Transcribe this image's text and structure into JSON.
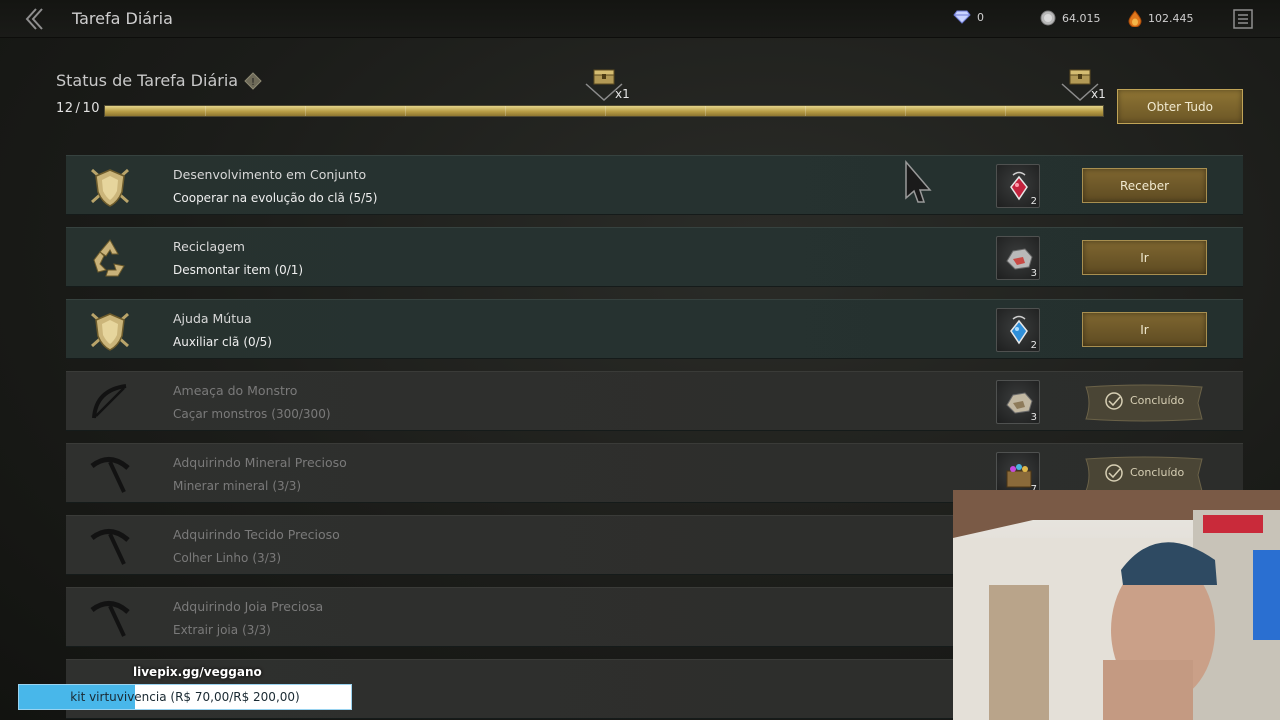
{
  "header": {
    "title": "Tarefa Diária",
    "currencies": [
      {
        "icon": "diamond-icon",
        "value": "0"
      },
      {
        "icon": "silver-coin-icon",
        "value": "64.015"
      },
      {
        "icon": "fire-gem-icon",
        "value": "102.445"
      }
    ]
  },
  "status": {
    "title": "Status de Tarefa Diária",
    "current": "12",
    "total": "10",
    "progress_fraction": 1.0,
    "milestones": [
      {
        "icon": "treasure-chest-icon",
        "multiplier": "x1"
      },
      {
        "icon": "treasure-chest-icon",
        "multiplier": "x1"
      }
    ],
    "obtain_all_label": "Obter Tudo"
  },
  "tasks": [
    {
      "name": "Desenvolvimento em Conjunto",
      "desc": "Cooperar na evolução do clã",
      "progress": "(5/5)",
      "icon": "clan-shield-icon",
      "reward_icon": "red-gem-amulet-icon",
      "reward_qty": "2",
      "action": "Receber",
      "done": false
    },
    {
      "name": "Reciclagem",
      "desc": "Desmontar item",
      "progress": "(0/1)",
      "icon": "recycle-icon",
      "reward_icon": "ore-chunk-icon",
      "reward_qty": "3",
      "action": "Ir",
      "done": false
    },
    {
      "name": "Ajuda Mútua",
      "desc": "Auxiliar clã",
      "progress": "(0/5)",
      "icon": "clan-shield-icon",
      "reward_icon": "blue-gem-amulet-icon",
      "reward_qty": "2",
      "action": "Ir",
      "done": false
    },
    {
      "name": "Ameaça do Monstro",
      "desc": "Caçar monstros",
      "progress": "(300/300)",
      "icon": "crossbow-icon",
      "reward_icon": "ore-chunk-icon",
      "reward_qty": "3",
      "action": "Concluído",
      "done": true
    },
    {
      "name": "Adquirindo Mineral Precioso",
      "desc": "Minerar mineral",
      "progress": "(3/3)",
      "icon": "pickaxe-icon",
      "reward_icon": "gem-chest-icon",
      "reward_qty": "7",
      "action": "Concluído",
      "done": true
    },
    {
      "name": "Adquirindo Tecido Precioso",
      "desc": "Colher Linho",
      "progress": "(3/3)",
      "icon": "pickaxe-icon",
      "done": true
    },
    {
      "name": "Adquirindo Joia Preciosa",
      "desc": "Extrair joia",
      "progress": "(3/3)",
      "icon": "pickaxe-icon",
      "done": true
    }
  ],
  "overlay": {
    "donation_name": "livepix.gg/veggano",
    "donation_goal": "kit virtuvivencia (R$ 70,00/R$ 200,00)",
    "donation_fraction": 0.35
  }
}
